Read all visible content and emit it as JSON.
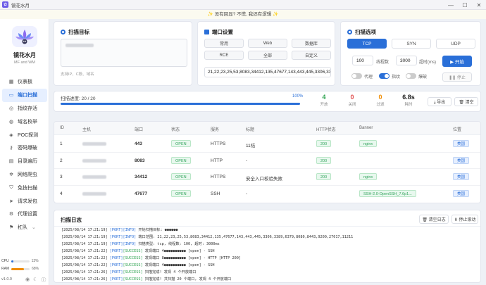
{
  "window": {
    "title": "镜花水月",
    "minimize": "—",
    "maximize": "☐",
    "close": "✕"
  },
  "notice": "✨ 没有回显? 不慌, 我还有逻辑 ✨",
  "sidebar": {
    "brand": "镜花水月",
    "sub": "MF and WM",
    "items": [
      {
        "label": "仪表板",
        "icon": "dashboard-icon"
      },
      {
        "label": "端口扫描",
        "icon": "port-scan-icon",
        "active": true
      },
      {
        "label": "指纹存活",
        "icon": "fingerprint-icon"
      },
      {
        "label": "域名枚举",
        "icon": "globe-icon"
      },
      {
        "label": "POC探测",
        "icon": "poc-icon"
      },
      {
        "label": "密码爆破",
        "icon": "key-icon"
      },
      {
        "label": "目录遍历",
        "icon": "folder-icon"
      },
      {
        "label": "网络爬虫",
        "icon": "spider-icon"
      },
      {
        "label": "免技扫描",
        "icon": "shield-scan-icon"
      },
      {
        "label": "请求发包",
        "icon": "send-icon"
      },
      {
        "label": "代理设置",
        "icon": "gear-icon"
      },
      {
        "label": "杠队",
        "icon": "team-icon"
      }
    ],
    "cpu_label": "CPU",
    "ram_label": "RAM",
    "cpu_pct": "13%",
    "ram_pct": "68%",
    "cpu_value": 0.13,
    "ram_value": 0.68,
    "version": "v1.0.0"
  },
  "target": {
    "title": "扫描目标",
    "hint": "支持IP、C段、域名"
  },
  "ports": {
    "title": "端口设置",
    "presets": [
      "常用",
      "Web",
      "数据库",
      "RCE",
      "全部",
      "自定义"
    ],
    "value": "21,22,23,25,53,8083,34412,135,47677,143,443,445,3306,3389,6379,8080,8443,9200,27017"
  },
  "options": {
    "title": "扫描选项",
    "protocols": [
      "TCP",
      "SYN",
      "UDP"
    ],
    "selected": "TCP",
    "threads": "100",
    "threads_label": "线程数",
    "timeout": "3000",
    "timeout_label": "超时(ms)",
    "start": "▶ 开始",
    "stop": "❚❚ 停止",
    "toggles": [
      {
        "label": "代理",
        "on": false
      },
      {
        "label": "指纹",
        "on": true
      },
      {
        "label": "爆破",
        "on": false
      }
    ]
  },
  "progress": {
    "label": "扫描进度: 20 / 20",
    "pct": "100%",
    "value": 1.0,
    "stats": [
      {
        "value": "4",
        "label": "开放",
        "color": "#2ca24f"
      },
      {
        "value": "0",
        "label": "关闭",
        "color": "#e04b4b"
      },
      {
        "value": "0",
        "label": "过滤",
        "color": "#f08c00"
      },
      {
        "value": "6.8s",
        "label": "耗时",
        "color": "#222222"
      }
    ],
    "export": "⤓ 导出",
    "clear": "🗑 清空"
  },
  "table": {
    "headers": [
      "ID",
      "主机",
      "端口",
      "状态",
      "服务",
      "标题",
      "HTTP状态",
      "Banner",
      "位置"
    ],
    "rows": [
      {
        "id": "1",
        "port": "443",
        "status": "OPEN",
        "service": "HTTPS",
        "title": "11结",
        "http": "200",
        "banner": "nginx",
        "loc": "美国"
      },
      {
        "id": "2",
        "port": "8083",
        "status": "OPEN",
        "service": "HTTP",
        "title": "-",
        "http": "200",
        "banner": "",
        "loc": "美国"
      },
      {
        "id": "3",
        "port": "34412",
        "status": "OPEN",
        "service": "HTTPS",
        "title": "安全入口校验失败",
        "http": "200",
        "banner": "nginx",
        "loc": "美国"
      },
      {
        "id": "4",
        "port": "47677",
        "status": "OPEN",
        "service": "SSH",
        "title": "-",
        "http": "",
        "banner": "SSH-2.0-OpenSSH_7.6p1...",
        "loc": "美国"
      }
    ]
  },
  "log": {
    "title": "扫描日志",
    "clear": "🗑 清空日志",
    "stop": "⬇ 停止滚动",
    "lines": [
      {
        "ts": "[2025/08/14 17:21:19]",
        "tag": "[PORT]",
        "lvl": "[INFO]",
        "msg": "开始扫描目标: ●●●●●●"
      },
      {
        "ts": "[2025/08/14 17:21:19]",
        "tag": "[PORT]",
        "lvl": "[INFO]",
        "msg": "端口范围: 21,22,23,25,53,8083,34412,135,47677,143,443,445,3306,3389,6379,8080,8443,9200,27017,11211"
      },
      {
        "ts": "[2025/08/14 17:21:19]",
        "tag": "[PORT]",
        "lvl": "[INFO]",
        "msg": "扫描类型: tcp, 线程数: 100, 超时: 3000ms"
      },
      {
        "ts": "[2025/08/14 17:21:22]",
        "tag": "[PORT]",
        "lvl": "[SUCCESS]",
        "msg": "发现端口 4●●●●●●●●●● [open] - SSH"
      },
      {
        "ts": "[2025/08/14 17:21:22]",
        "tag": "[PORT]",
        "lvl": "[SUCCESS]",
        "msg": "发现端口 8●●●●●●●●●● [open] - HTTP [HTTP 200]"
      },
      {
        "ts": "[2025/08/14 17:21:22]",
        "tag": "[PORT]",
        "lvl": "[SUCCESS]",
        "msg": "发现端口 4●●●●●●●●●● [open] - SSH"
      },
      {
        "ts": "[2025/08/14 17:21:26]",
        "tag": "[PORT]",
        "lvl": "[SUCCESS]",
        "msg": "扫描完成! 发现 4 个开放端口"
      },
      {
        "ts": "[2025/08/14 17:21:26]",
        "tag": "[PORT]",
        "lvl": "[SUCCESS]",
        "msg": "扫描完成! 共扫描 20 个端口, 发现 4 个开放端口"
      }
    ]
  },
  "colors": {
    "accent": "#2a6fd8",
    "success": "#2ca24f",
    "danger": "#e04b4b",
    "warning": "#f08c00"
  }
}
